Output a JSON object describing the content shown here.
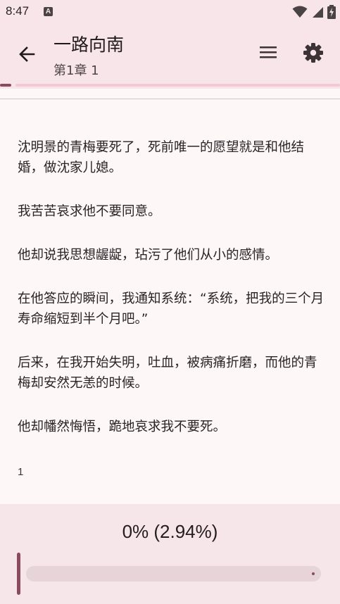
{
  "status_bar": {
    "time": "8:47",
    "notification_badge": "A",
    "icons": [
      "wifi-icon",
      "cell-signal-icon",
      "battery-charging-icon"
    ]
  },
  "app_bar": {
    "title": "一路向南",
    "subtitle": "第1章 1",
    "icons": [
      "back-arrow-icon",
      "menu-icon",
      "settings-icon"
    ]
  },
  "content": {
    "paragraphs": [
      "沈明景的青梅要死了，死前唯一的愿望就是和他结婚，做沈家儿媳。",
      "我苦苦哀求他不要同意。",
      "他却说我思想龌龊，玷污了他们从小的感情。",
      "在他答应的瞬间，我通知系统：“系统，把我的三个月寿命缩短到半个月吧。”",
      "后来，在我开始失明，吐血，被病痛折磨，而他的青梅却安然无恙的时候。",
      "他却幡然悔悟，跪地哀求我不要死。"
    ],
    "page_number": "1"
  },
  "bottom_panel": {
    "progress_text": "0% (2.94%)",
    "progress_fraction": 0.0294
  },
  "colors": {
    "accent": "#8c4a60",
    "bar_background": "#f8e5ea",
    "page_background": "#fdf7f8",
    "track": "#e7d4d9"
  }
}
